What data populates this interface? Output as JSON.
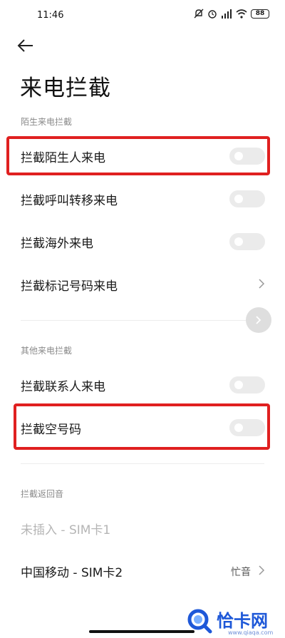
{
  "status": {
    "time": "11:46",
    "battery": "88"
  },
  "header": {
    "back_icon": "arrow-left-icon",
    "title": "来电拦截"
  },
  "sections": [
    {
      "header": "陌生来电拦截",
      "items": [
        {
          "label": "拦截陌生人来电",
          "control": "toggle",
          "on": false
        },
        {
          "label": "拦截呼叫转移来电",
          "control": "toggle",
          "on": false
        },
        {
          "label": "拦截海外来电",
          "control": "toggle",
          "on": false
        },
        {
          "label": "拦截标记号码来电",
          "control": "chevron"
        }
      ]
    },
    {
      "header": "其他来电拦截",
      "items": [
        {
          "label": "拦截联系人来电",
          "control": "toggle",
          "on": false
        },
        {
          "label": "拦截空号码",
          "control": "toggle",
          "on": false
        }
      ]
    },
    {
      "header": "拦截返回音",
      "items": [
        {
          "label": "未插入 - SIM卡1",
          "control": "none",
          "disabled": true
        },
        {
          "label": "中国移动 - SIM卡2",
          "control": "chevron",
          "value": "忙音"
        }
      ]
    }
  ],
  "watermark": {
    "text": "恰卡网",
    "url": "www.qiaqa.com"
  },
  "colors": {
    "highlight": "#e02020",
    "toggle_off": "#ebebeb",
    "watermark": "#1e58d8"
  }
}
